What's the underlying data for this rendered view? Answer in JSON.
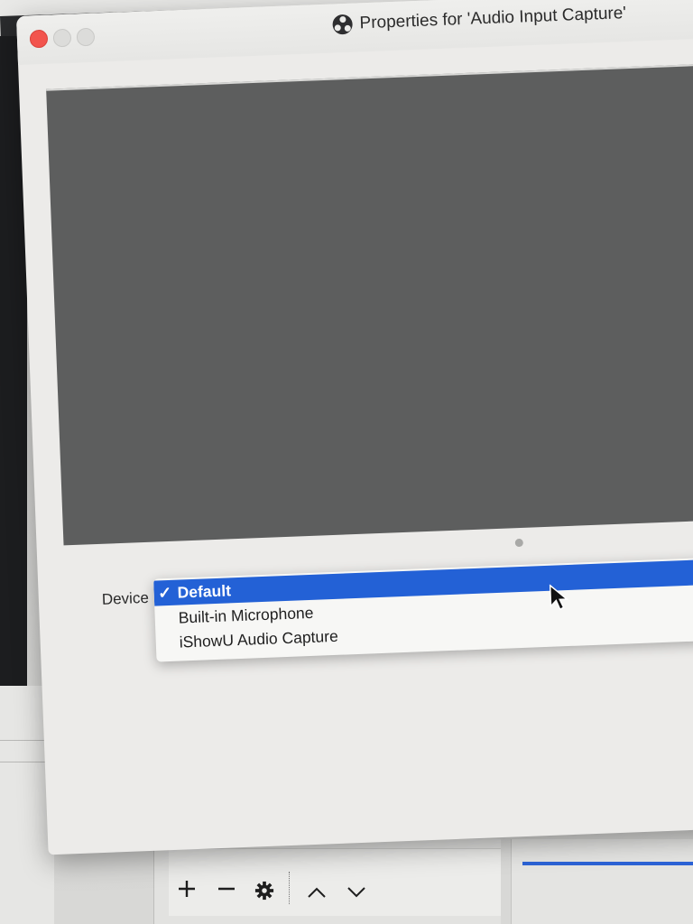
{
  "dialog": {
    "title": "Properties for 'Audio Input Capture'",
    "device_label": "Device",
    "device_options": [
      {
        "label": "Default",
        "selected": true,
        "check": "✓"
      },
      {
        "label": "Built-in Microphone",
        "selected": false,
        "check": ""
      },
      {
        "label": "iShowU Audio Capture",
        "selected": false,
        "check": ""
      }
    ]
  },
  "toolbar": {
    "add_icon": "plus-icon",
    "remove_icon": "minus-icon",
    "settings_icon": "gear-icon",
    "up_icon": "chevron-up-icon",
    "down_icon": "chevron-down-icon"
  },
  "colors": {
    "selection": "#2361d6",
    "close_button": "#f2544d",
    "preview_bg": "#5d5e5e"
  }
}
